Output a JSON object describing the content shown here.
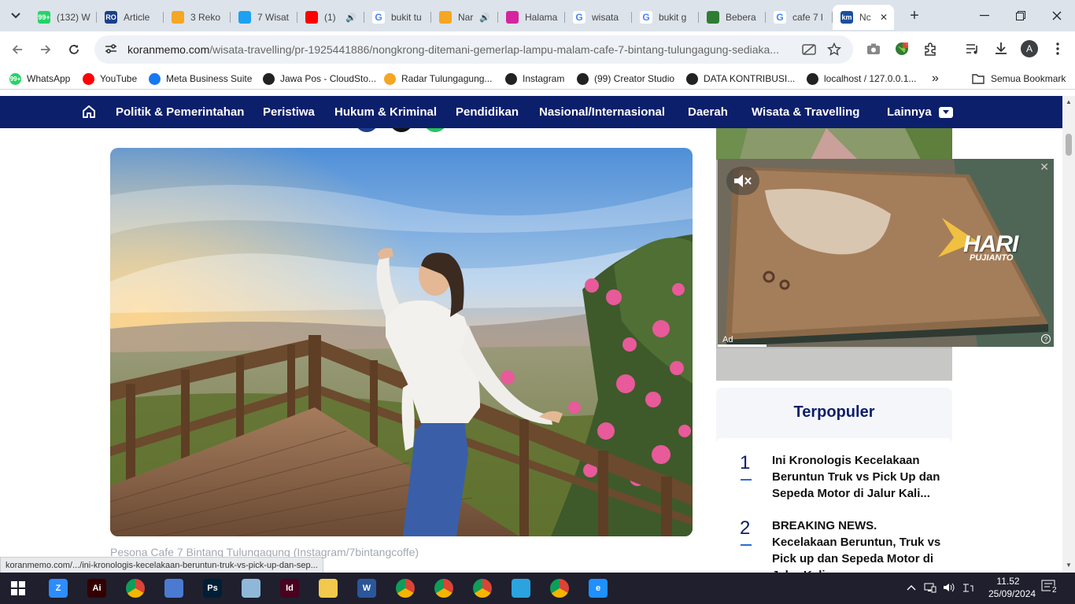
{
  "browser": {
    "tabs": [
      {
        "title": "(132) W",
        "favicon": "whatsapp-icon",
        "color": "#25d366",
        "badge": "99+"
      },
      {
        "title": "Article",
        "favicon": "article-icon",
        "color": "#1a3e8c",
        "badge": "RO"
      },
      {
        "title": "3 Reko",
        "favicon": "radar-icon",
        "color": "#f5a623",
        "badge": ""
      },
      {
        "title": "7 Wisat",
        "favicon": "bird-icon",
        "color": "#1da1f2",
        "badge": ""
      },
      {
        "title": "(1)",
        "favicon": "youtube-icon",
        "color": "#ff0000",
        "badge": "",
        "audio": true
      },
      {
        "title": "bukit tu",
        "favicon": "google-icon",
        "color": "#ffffff",
        "badge": "G"
      },
      {
        "title": "Nar",
        "favicon": "radar-icon",
        "color": "#f5a623",
        "badge": "",
        "audio": true
      },
      {
        "title": "Halama",
        "favicon": "instagram-icon",
        "color": "#d6249f",
        "badge": ""
      },
      {
        "title": "wisata",
        "favicon": "google-icon",
        "color": "#ffffff",
        "badge": "G"
      },
      {
        "title": "bukit g",
        "favicon": "google-icon",
        "color": "#ffffff",
        "badge": "G"
      },
      {
        "title": "Bebera",
        "favicon": "cp-icon",
        "color": "#2e7d32",
        "badge": ""
      },
      {
        "title": "cafe 7 l",
        "favicon": "google-icon",
        "color": "#ffffff",
        "badge": "G"
      },
      {
        "title": "Nc",
        "favicon": "koranmemo-icon",
        "color": "#1b4fa0",
        "badge": "km",
        "active": true
      }
    ],
    "url_domain": "koranmemo.com",
    "url_path": "/wisata-travelling/pr-1925441886/nongkrong-ditemani-gemerlap-lampu-malam-cafe-7-bintang-tulungagung-sediaka...",
    "profile_initial": "A",
    "bookmarks": [
      {
        "label": "WhatsApp",
        "icon": "whatsapp-icon",
        "color": "#25d366",
        "badge": "99+"
      },
      {
        "label": "YouTube",
        "icon": "youtube-icon",
        "color": "#ff0000",
        "badge": ""
      },
      {
        "label": "Meta Business Suite",
        "icon": "meta-icon",
        "color": "#1877f2",
        "badge": ""
      },
      {
        "label": "Jawa Pos - CloudSto...",
        "icon": "globe-icon",
        "color": "#222222",
        "badge": ""
      },
      {
        "label": "Radar Tulungagung...",
        "icon": "radar-icon",
        "color": "#f5a623",
        "badge": ""
      },
      {
        "label": "Instagram",
        "icon": "globe-icon",
        "color": "#222222",
        "badge": ""
      },
      {
        "label": "(99) Creator Studio",
        "icon": "globe-icon",
        "color": "#222222",
        "badge": ""
      },
      {
        "label": "DATA KONTRIBUSI...",
        "icon": "globe-icon",
        "color": "#222222",
        "badge": ""
      },
      {
        "label": "localhost / 127.0.0.1...",
        "icon": "globe-icon",
        "color": "#222222",
        "badge": ""
      }
    ],
    "bookmarks_overflow": "»",
    "all_bookmarks": "Semua Bookmark",
    "status_url": "koranmemo.com/.../ini-kronologis-kecelakaan-beruntun-truk-vs-pick-up-dan-sep..."
  },
  "site": {
    "nav": [
      "Politik & Pemerintahan",
      "Peristiwa",
      "Hukum & Kriminal",
      "Pendidikan",
      "Nasional/Internasional",
      "Daerah",
      "Wisata & Travelling",
      "Lainnya"
    ],
    "image_caption": "Pesona Cafe 7 Bintang Tulungagung (Instagram/7bintangcoffe)",
    "ad": {
      "label": "Ad",
      "logo_line1": "HARI",
      "logo_line2": "PUJIANTO",
      "close": "✕",
      "help": "?"
    },
    "popular": {
      "title": "Terpopuler",
      "items": [
        {
          "rank": "1",
          "title": "Ini Kronologis Kecelakaan Beruntun Truk vs Pick Up dan Sepeda Motor di Jalur Kali..."
        },
        {
          "rank": "2",
          "title": "BREAKING NEWS. Kecelakaan Beruntun, Truk vs Pick up dan Sepeda Motor di Jalur Kali..."
        }
      ]
    }
  },
  "taskbar": {
    "time": "11.52",
    "date": "25/09/2024",
    "notifications": "2",
    "apps": [
      {
        "name": "zoom-icon",
        "color": "#2d8cff",
        "label": "Z"
      },
      {
        "name": "illustrator-icon",
        "color": "#330000",
        "label": "Ai"
      },
      {
        "name": "chrome-icon",
        "color": "#db4437",
        "label": ""
      },
      {
        "name": "remote-desktop-icon",
        "color": "#4a7bd1",
        "label": ""
      },
      {
        "name": "photoshop-icon",
        "color": "#001e36",
        "label": "Ps"
      },
      {
        "name": "notepad-icon",
        "color": "#8fb8d8",
        "label": ""
      },
      {
        "name": "indesign-icon",
        "color": "#49021f",
        "label": "Id"
      },
      {
        "name": "file-explorer-icon",
        "color": "#f2c94c",
        "label": ""
      },
      {
        "name": "word-icon",
        "color": "#2b579a",
        "label": "W"
      },
      {
        "name": "chrome-profile-icon",
        "color": "#db4437",
        "label": ""
      },
      {
        "name": "chrome-profile-icon",
        "color": "#db4437",
        "label": ""
      },
      {
        "name": "chrome-profile-icon",
        "color": "#db4437",
        "label": ""
      },
      {
        "name": "telegram-icon",
        "color": "#2aa3df",
        "label": ""
      },
      {
        "name": "chrome-profile-icon",
        "color": "#db4437",
        "label": ""
      },
      {
        "name": "edge-icon",
        "color": "#1e90ff",
        "label": "e"
      }
    ]
  }
}
